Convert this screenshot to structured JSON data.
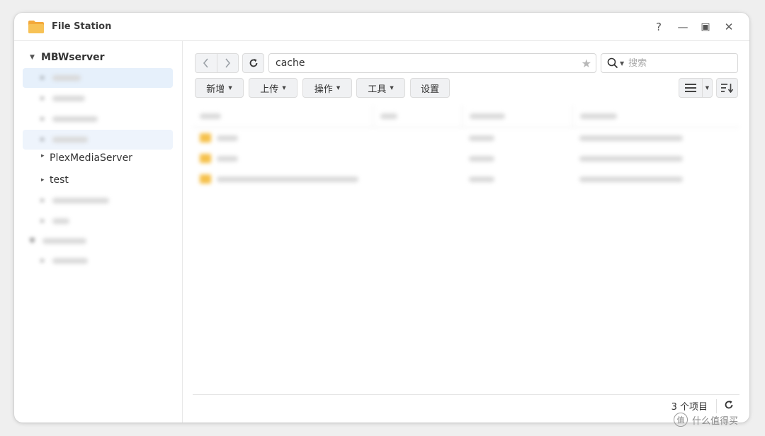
{
  "window": {
    "title": "File Station",
    "controls": {
      "help": "?",
      "minimize": "—",
      "maximize": "▣",
      "close": "✕"
    }
  },
  "sidebar": {
    "root": "MBWserver",
    "items": [
      {
        "label": "",
        "blurred": true,
        "selected": true
      },
      {
        "label": "",
        "blurred": true
      },
      {
        "label": "",
        "blurred": true
      },
      {
        "label": "",
        "blurred": true,
        "highlighted": true
      },
      {
        "label": "PlexMediaServer"
      },
      {
        "label": "test"
      },
      {
        "label": "",
        "blurred": true
      },
      {
        "label": "",
        "blurred": true
      }
    ],
    "second_root": {
      "label": "",
      "blurred": true
    },
    "second_items": [
      {
        "label": "",
        "blurred": true
      }
    ]
  },
  "toolbar": {
    "path": "cache",
    "search_placeholder": "搜索",
    "buttons": {
      "create": "新增",
      "upload": "上传",
      "action": "操作",
      "tools": "工具",
      "settings": "设置"
    }
  },
  "file_list": {
    "blurred": true,
    "rows": [
      {
        "type": "folder"
      },
      {
        "type": "folder"
      },
      {
        "type": "folder"
      }
    ]
  },
  "footer": {
    "count": "3 个项目"
  },
  "watermark": {
    "text": "什么值得买",
    "mark": "值"
  },
  "icons": {
    "app": "file-station-folder-icon",
    "back": "chevron-left-icon",
    "forward": "chevron-right-icon",
    "refresh": "refresh-icon",
    "star": "star-icon",
    "search": "search-icon",
    "list_view": "list-view-icon",
    "sort": "sort-icon"
  },
  "colors": {
    "accent_selected": "#e6f0fb",
    "folder": "#f5c04a"
  }
}
